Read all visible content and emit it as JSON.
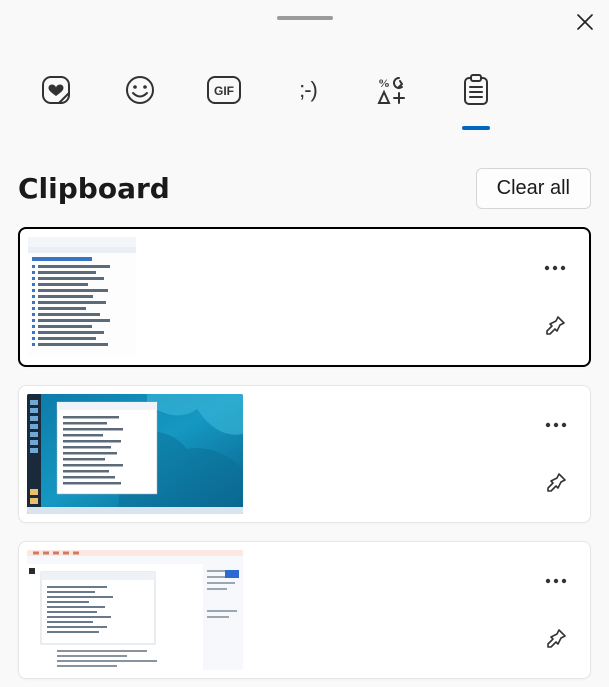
{
  "panel": {
    "title": "Clipboard",
    "clear_all_label": "Clear all"
  },
  "tabs": {
    "items": [
      {
        "id": "stickers",
        "icon": "heart-sticker-icon",
        "active": false
      },
      {
        "id": "emoji",
        "icon": "smiley-icon",
        "active": false
      },
      {
        "id": "gif",
        "icon": "gif-icon",
        "active": false
      },
      {
        "id": "kaomoji",
        "icon": "kaomoji-icon",
        "text": ";-)",
        "active": false
      },
      {
        "id": "symbols",
        "icon": "symbols-icon",
        "active": false
      },
      {
        "id": "clipboard",
        "icon": "clipboard-icon",
        "active": true
      }
    ]
  },
  "clipboard": {
    "items": [
      {
        "kind": "image",
        "description": "Device Manager window screenshot (white list view)",
        "selected": true,
        "pinned": false
      },
      {
        "kind": "image",
        "description": "Desktop screenshot with ocean wallpaper and file explorer window",
        "selected": false,
        "pinned": false
      },
      {
        "kind": "image",
        "description": "Browser window screenshot with developer tools pane",
        "selected": false,
        "pinned": false
      }
    ]
  }
}
